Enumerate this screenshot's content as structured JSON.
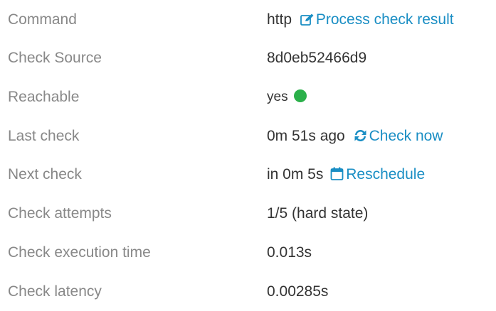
{
  "rows": [
    {
      "label": "Command",
      "value": "http",
      "action": {
        "label": "Process check result",
        "icon": "edit-icon"
      }
    },
    {
      "label": "Check Source",
      "value": "8d0eb52466d9"
    },
    {
      "label": "Reachable",
      "value": "yes",
      "status_color": "#2bb04a"
    },
    {
      "label": "Last check",
      "value": "0m 51s ago",
      "action": {
        "label": "Check now",
        "icon": "refresh-icon"
      }
    },
    {
      "label": "Next check",
      "value": "in 0m 5s",
      "action": {
        "label": "Reschedule",
        "icon": "calendar-icon"
      }
    },
    {
      "label": "Check attempts",
      "value": "1/5 (hard state)"
    },
    {
      "label": "Check execution time",
      "value": "0.013s"
    },
    {
      "label": "Check latency",
      "value": "0.00285s"
    }
  ],
  "colors": {
    "label": "#888888",
    "value": "#333333",
    "link": "#1a8ec4"
  }
}
